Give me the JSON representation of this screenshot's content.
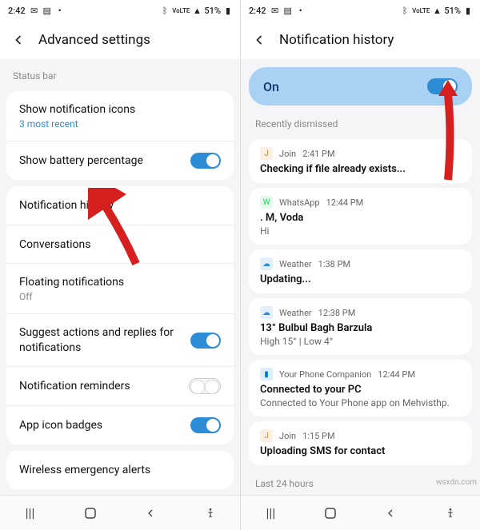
{
  "status": {
    "time": "2:42",
    "battery": "51%",
    "network": "VoLTE"
  },
  "left": {
    "title": "Advanced settings",
    "status_bar_label": "Status bar",
    "show_icons": "Show notification icons",
    "show_icons_sub": "3 most recent",
    "battery_pct": "Show battery percentage",
    "notif_history": "Notification history",
    "conversations": "Conversations",
    "floating": "Floating notifications",
    "floating_sub": "Off",
    "suggest": "Suggest actions and replies for notifications",
    "reminders": "Notification reminders",
    "badges": "App icon badges",
    "emergency": "Wireless emergency alerts"
  },
  "right": {
    "title": "Notification history",
    "on": "On",
    "recently": "Recently dismissed",
    "last24": "Last 24 hours",
    "items": [
      {
        "app": "Join",
        "time": "2:41 PM",
        "title": "Checking if file already exists...",
        "body": "",
        "icon": "J",
        "color": "#d98c3a"
      },
      {
        "app": "WhatsApp",
        "time": "12:44 PM",
        "title": ". M, Voda",
        "body": "Hi",
        "icon": "W",
        "color": "#25d366"
      },
      {
        "app": "Weather",
        "time": "1:38 PM",
        "title": "Updating...",
        "body": "",
        "icon": "☁",
        "color": "#2d8cd6"
      },
      {
        "app": "Weather",
        "time": "12:38 PM",
        "title": "13° Bulbul Bagh Barzula",
        "body": "High 15° | Low 4°",
        "icon": "☁",
        "color": "#2d8cd6"
      },
      {
        "app": "Your Phone Companion",
        "time": "12:44 PM",
        "title": "Connected to your PC",
        "body": "Connected to Your Phone app on Mehvisthp.",
        "icon": "▮",
        "color": "#0078d4"
      },
      {
        "app": "Join",
        "time": "1:15 PM",
        "title": "Uploading SMS for contact",
        "body": "",
        "icon": "J",
        "color": "#d98c3a"
      }
    ]
  },
  "watermark": "wsxdn.com"
}
